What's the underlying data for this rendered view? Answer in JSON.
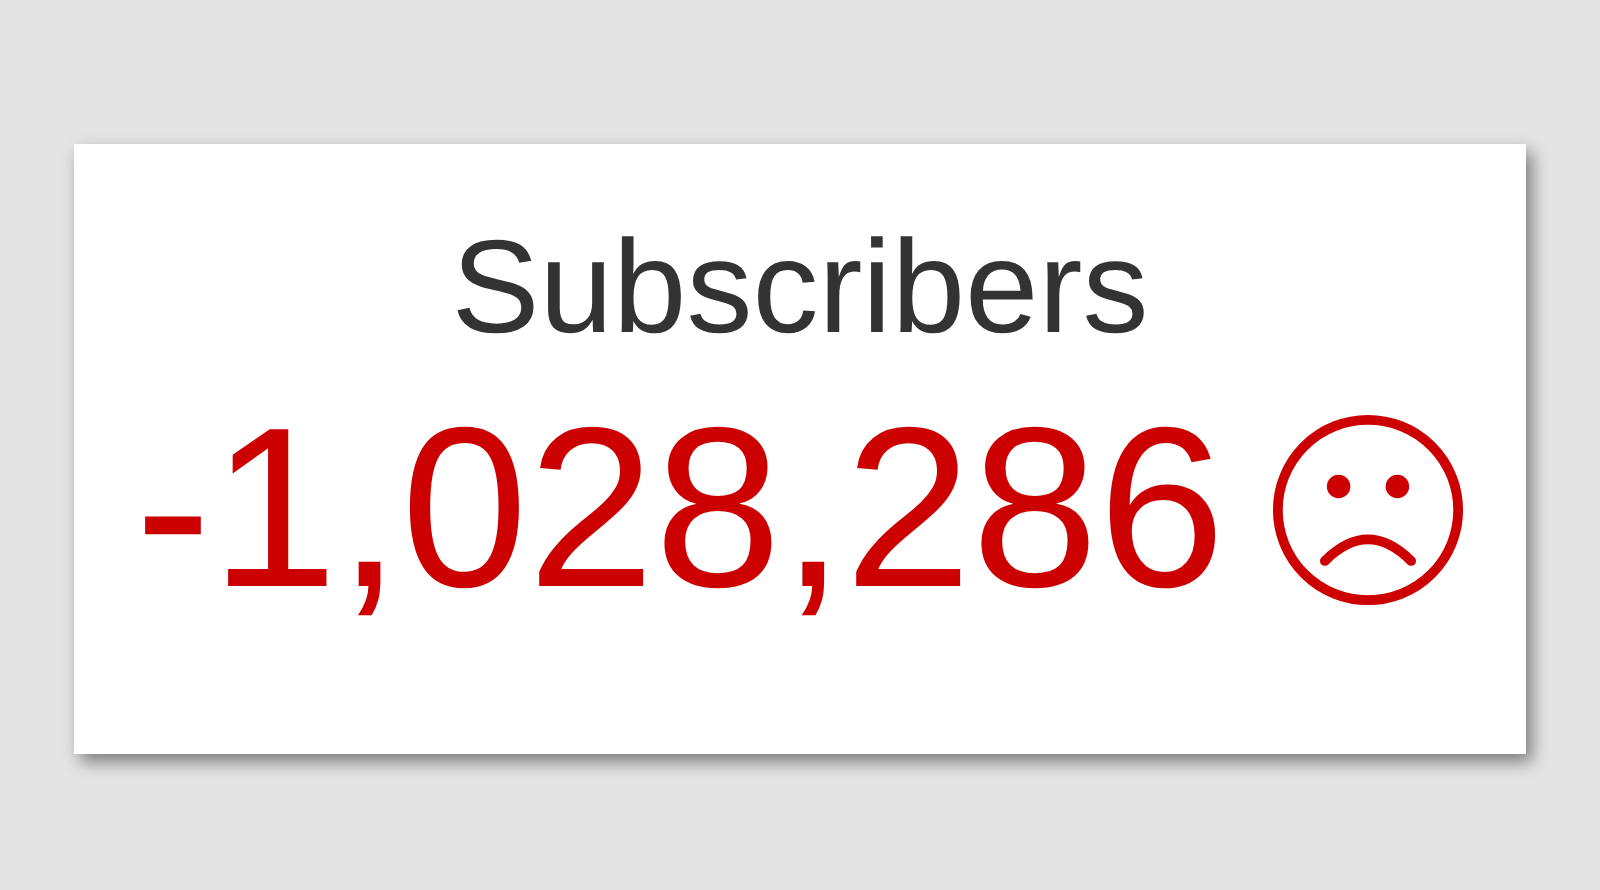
{
  "card": {
    "title": "Subscribers",
    "count": "-1,028,286"
  }
}
